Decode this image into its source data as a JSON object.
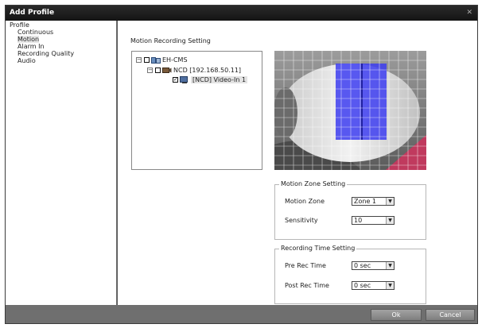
{
  "window": {
    "title": "Add Profile",
    "close_icon": "close-icon"
  },
  "sidebar": {
    "items": [
      {
        "label": "Profile",
        "level": 0
      },
      {
        "label": "Continuous",
        "level": 1
      },
      {
        "label": "Motion",
        "level": 1,
        "selected": true
      },
      {
        "label": "Alarm In",
        "level": 1
      },
      {
        "label": "Recording Quality",
        "level": 1
      },
      {
        "label": "Audio",
        "level": 1
      }
    ]
  },
  "main": {
    "section_title": "Motion Recording Setting",
    "tree": {
      "root": {
        "label": "EH-CMS",
        "expander": "−"
      },
      "device": {
        "label": "NCD [192.168.50.11]",
        "expander": "−"
      },
      "channel": {
        "label": "[NCD] Video-In 1",
        "checked": true
      }
    },
    "motion_zone_setting": {
      "title": "Motion Zone Setting",
      "zone_label": "Motion Zone",
      "zone_value": "Zone 1",
      "sensitivity_label": "Sensitivity",
      "sensitivity_value": "10"
    },
    "recording_time_setting": {
      "title": "Recording Time Setting",
      "pre_label": "Pre Rec Time",
      "pre_value": "0 sec",
      "post_label": "Post Rec Time",
      "post_value": "0 sec"
    }
  },
  "footer": {
    "ok_label": "Ok",
    "cancel_label": "Cancel"
  },
  "colors": {
    "titlebar": "#1c1c1c",
    "dialog_frame": "#6f6f6f",
    "motion_zone": "#3d3df0",
    "selection": "#e6e6e6"
  }
}
